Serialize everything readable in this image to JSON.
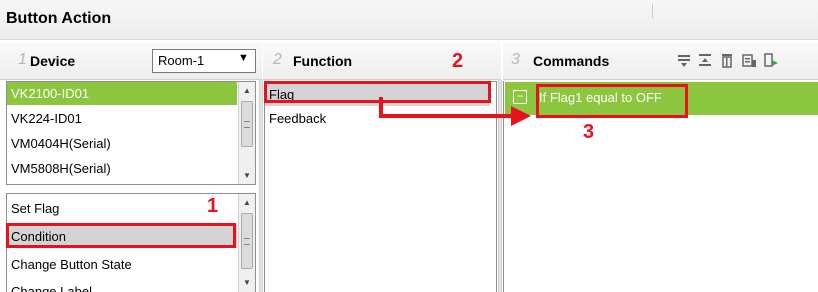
{
  "window": {
    "title": "Button Action"
  },
  "device_panel": {
    "number": "1",
    "header": "Device",
    "room_select": {
      "value": "Room-1"
    },
    "devices": [
      "VK2100-ID01",
      "VK224-ID01",
      "VM0404H(Serial)",
      "VM5808H(Serial)"
    ],
    "actions": [
      "Set Flag",
      "Condition",
      "Change Button State",
      "Change Label"
    ]
  },
  "function_panel": {
    "number": "2",
    "header": "Function",
    "items": [
      "Flag",
      "Feedback"
    ]
  },
  "commands_panel": {
    "number": "3",
    "header": "Commands",
    "toolbar_icons": [
      "insert-command-icon",
      "move-command-icon",
      "delete-icon",
      "edit-icon",
      "run-icon"
    ],
    "commands": [
      {
        "expander": "−",
        "text": "If Flag1 equal to OFF"
      }
    ]
  },
  "annotations": {
    "step1": "1",
    "step2": "2",
    "step3": "3"
  },
  "colors": {
    "selection": "#8cc63e",
    "annotation": "#e8121f",
    "highlight": "#d4d4d4"
  }
}
